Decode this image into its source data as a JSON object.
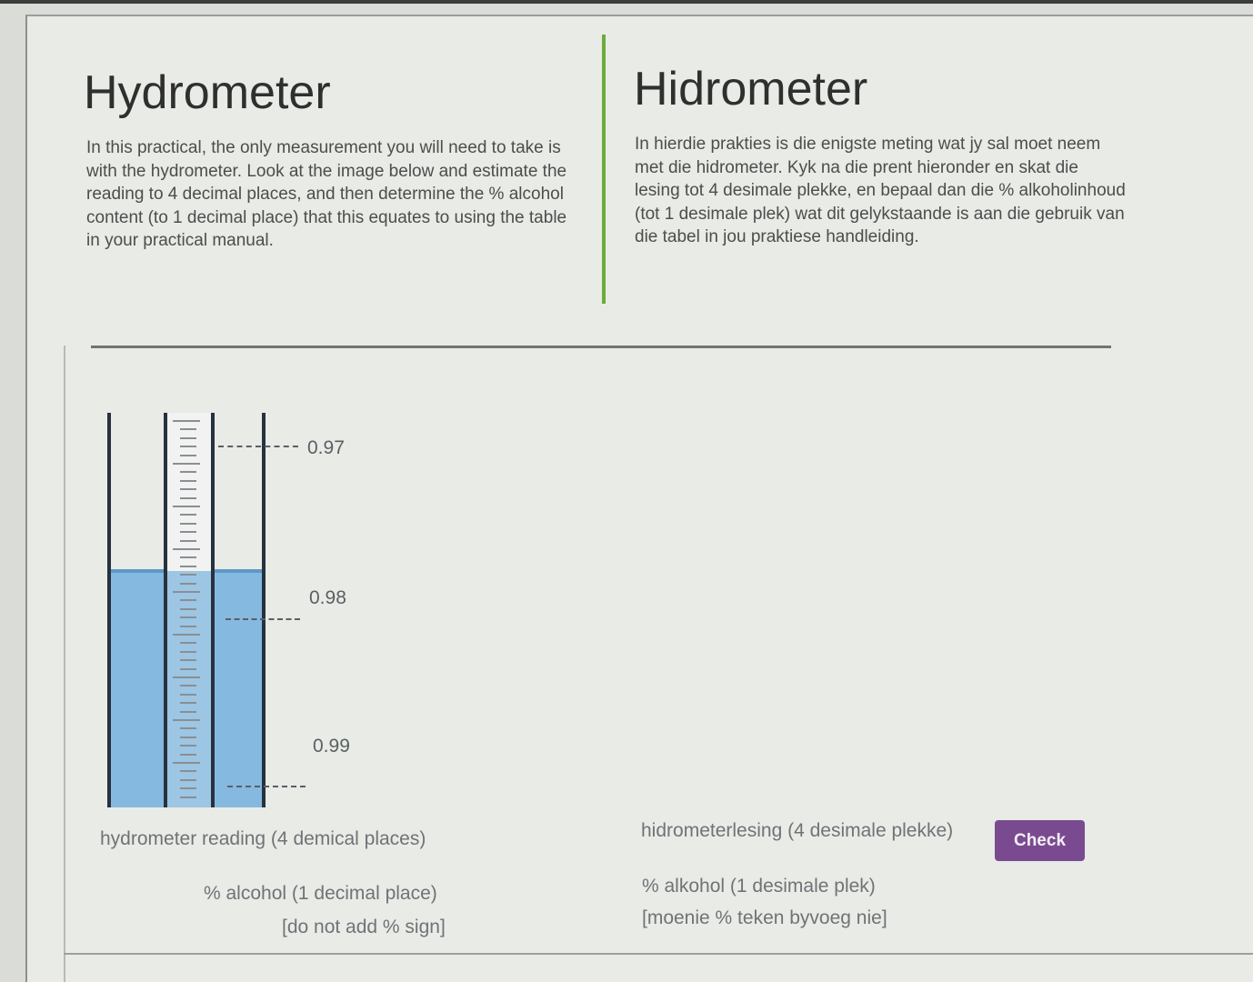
{
  "english": {
    "title": "Hydrometer",
    "instructions": "In this practical, the only measurement you will need to take is with the hydrometer. Look at the image below and estimate the reading to 4 decimal places, and then determine the % alcohol content (to 1 decimal place) that this equates to using the table in your practical manual."
  },
  "afrikaans": {
    "title": "Hidrometer",
    "instructions": "In hierdie prakties is die enigste meting wat jy sal moet neem met die hidrometer. Kyk na die prent hieronder en skat die lesing tot 4 desimale plekke, en bepaal dan die % alkoholinhoud (tot 1 desimale plek) wat dit gelykstaande is aan die gebruik van die tabel in jou praktiese handleiding."
  },
  "hydrometer_figure": {
    "scale_labels": [
      "0.97",
      "0.98",
      "0.99"
    ],
    "colors": {
      "liquid": "#86b9e0",
      "wall": "#27323f"
    }
  },
  "form": {
    "reading_label_en": "hydrometer reading (4 demical places)",
    "reading_label_af": "hidrometerlesing (4 desimale plekke)",
    "alcohol_label_en_line1": "% alcohol (1 decimal place)",
    "alcohol_label_en_line2": "[do not add % sign]",
    "alcohol_label_af_line1": "% alkohol (1 desimale plek)",
    "alcohol_label_af_line2": "[moenie % teken byvoeg nie]",
    "check_label": "Check",
    "check_color": "#7a4a90"
  }
}
